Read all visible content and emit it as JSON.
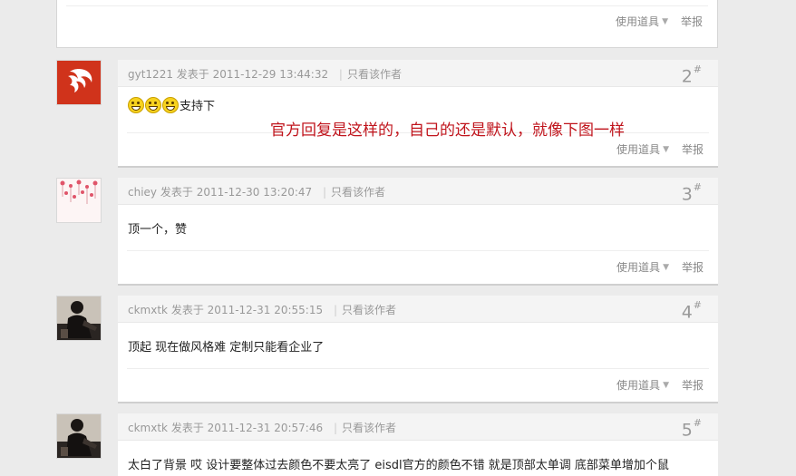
{
  "common": {
    "tools_label": "使用道具",
    "report_label": "举报",
    "posted_at_prefix": "发表于",
    "only_author_label": "只看该作者",
    "floor_mark": "#"
  },
  "annotation": "官方回复是这样的，自己的还是默认，就像下图一样",
  "posts": [
    {
      "author": "gyt1221",
      "datetime": "2011-12-29 13:44:32",
      "floor": "2",
      "content": "支持下",
      "emoticons": [
        "grin-emoticon",
        "grin-emoticon",
        "grin-emoticon"
      ],
      "avatar_icon": "red-swirl-logo-icon"
    },
    {
      "author": "chiey",
      "datetime": "2011-12-30 13:20:47",
      "floor": "3",
      "content": "顶一个，赞",
      "avatar_icon": "floral-pattern-icon"
    },
    {
      "author": "ckmxtk",
      "datetime": "2011-12-31 20:55:15",
      "floor": "4",
      "content": "顶起 现在做风格难 定制只能看企业了",
      "avatar_icon": "person-photo-icon"
    },
    {
      "author": "ckmxtk",
      "datetime": "2011-12-31 20:57:46",
      "floor": "5",
      "content": "太白了背景 哎 设计要整体过去颜色不要太亮了 eisdl官方的颜色不错 就是顶部太单调 底部菜单增加个鼠",
      "avatar_icon": "person-photo-icon"
    }
  ],
  "colors": {
    "annotation": "#c0141c",
    "background": "#ebebeb",
    "avatar_red": "#d0331b",
    "emoticon_yellow": "#f7d21f"
  }
}
